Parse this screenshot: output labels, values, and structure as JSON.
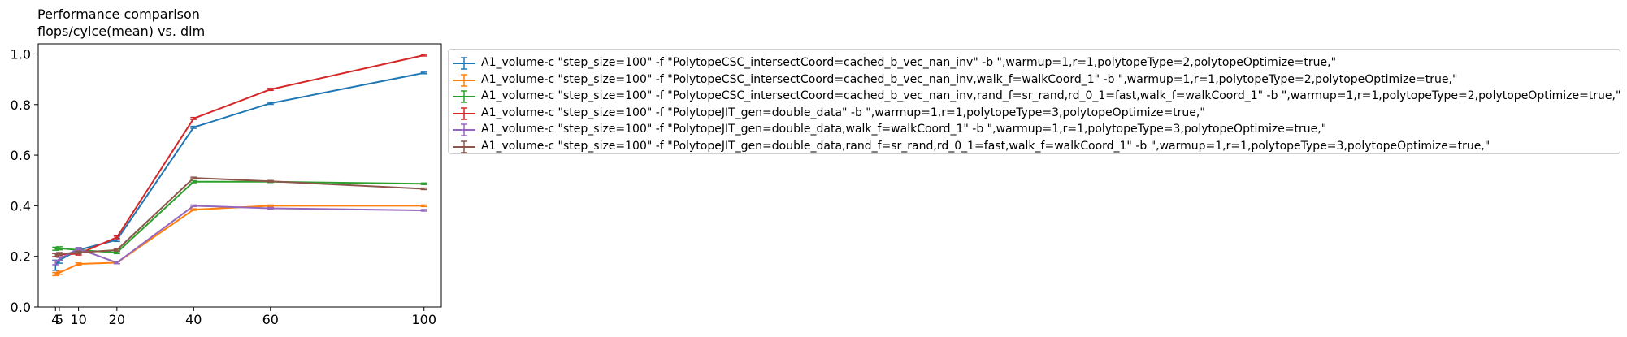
{
  "chart_data": {
    "type": "line",
    "title": "Performance comparison",
    "subtitle": "flops/cylce(mean) vs. dim",
    "xlabel": "",
    "ylabel": "",
    "x": [
      4,
      5,
      10,
      20,
      40,
      60,
      100
    ],
    "xticks": [
      4,
      5,
      10,
      20,
      40,
      60,
      100
    ],
    "xlim": [
      -0.5,
      104.5
    ],
    "yticks": [
      0.0,
      0.2,
      0.4,
      0.6,
      0.8,
      1.0
    ],
    "ylim": [
      0.0,
      1.04
    ],
    "grid": false,
    "legend_position": "outside-right",
    "error_bars": true,
    "series": [
      {
        "name": "A1_volume-c \"step_size=100\" -f \"PolytopeCSC_intersectCoord=cached_b_vec_nan_inv\" -b \",warmup=1,r=1,polytopeType=2,polytopeOptimize=true,\"",
        "color": "#1f77b4",
        "values": [
          0.165,
          0.185,
          0.225,
          0.265,
          0.71,
          0.805,
          0.925
        ],
        "errors": [
          0.02,
          0.012,
          0.006,
          0.006,
          0.004,
          0.004,
          0.003
        ]
      },
      {
        "name": "A1_volume-c \"step_size=100\" -f \"PolytopeCSC_intersectCoord=cached_b_vec_nan_inv,walk_f=walkCoord_1\" -b \",warmup=1,r=1,polytopeType=2,polytopeOptimize=true,\"",
        "color": "#ff7f0e",
        "values": [
          0.13,
          0.135,
          0.17,
          0.175,
          0.385,
          0.4,
          0.4
        ],
        "errors": [
          0.006,
          0.006,
          0.004,
          0.004,
          0.003,
          0.003,
          0.003
        ]
      },
      {
        "name": "A1_volume-c \"step_size=100\" -f \"PolytopeCSC_intersectCoord=cached_b_vec_nan_inv,rand_f=sr_rand,rd_0_1=fast,walk_f=walkCoord_1\" -b \",warmup=1,r=1,polytopeType=2,polytopeOptimize=true,\"",
        "color": "#2ca02c",
        "values": [
          0.23,
          0.232,
          0.225,
          0.215,
          0.495,
          0.495,
          0.487
        ],
        "errors": [
          0.006,
          0.006,
          0.005,
          0.004,
          0.004,
          0.003,
          0.003
        ]
      },
      {
        "name": "A1_volume-c \"step_size=100\" -f \"PolytopeJIT_gen=double_data\" -b \",warmup=1,r=1,polytopeType=3,polytopeOptimize=true,\"",
        "color": "#d62728",
        "values": [
          0.205,
          0.208,
          0.21,
          0.275,
          0.745,
          0.86,
          0.995
        ],
        "errors": [
          0.006,
          0.005,
          0.005,
          0.005,
          0.004,
          0.004,
          0.003
        ]
      },
      {
        "name": "A1_volume-c \"step_size=100\" -f \"PolytopeJIT_gen=double_data,walk_f=walkCoord_1\" -b \",warmup=1,r=1,polytopeType=3,polytopeOptimize=true,\"",
        "color": "#9467bd",
        "values": [
          0.175,
          0.19,
          0.23,
          0.175,
          0.4,
          0.39,
          0.382
        ],
        "errors": [
          0.008,
          0.006,
          0.005,
          0.004,
          0.003,
          0.003,
          0.003
        ]
      },
      {
        "name": "A1_volume-c \"step_size=100\" -f \"PolytopeJIT_gen=double_data,rand_f=sr_rand,rd_0_1=fast,walk_f=walkCoord_1\" -b \",warmup=1,r=1,polytopeType=3,polytopeOptimize=true,\"",
        "color": "#8c564b",
        "values": [
          0.205,
          0.21,
          0.215,
          0.225,
          0.51,
          0.497,
          0.467
        ],
        "errors": [
          0.006,
          0.005,
          0.005,
          0.004,
          0.003,
          0.003,
          0.003
        ]
      }
    ]
  }
}
